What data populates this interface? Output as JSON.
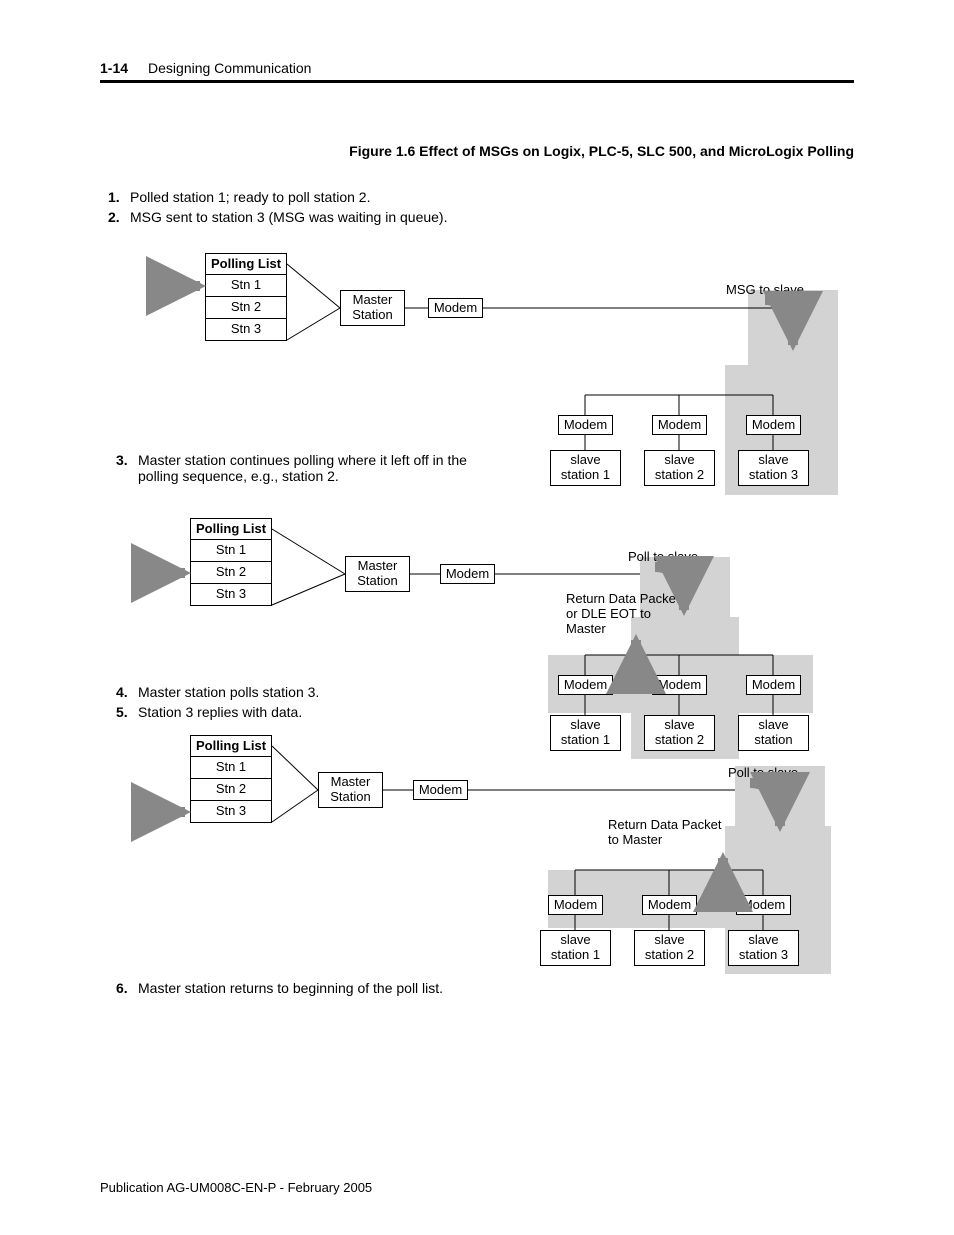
{
  "header": {
    "pgnum": "1-14",
    "section": "Designing Communication"
  },
  "figure_caption": "Figure 1.6    Effect of MSGs on Logix, PLC-5, SLC 500, and MicroLogix Polling",
  "steps": {
    "s1": {
      "n": "1.",
      "t": "Polled station 1; ready to poll station 2."
    },
    "s2": {
      "n": "2.",
      "t": "MSG sent to station 3 (MSG was waiting in queue)."
    },
    "s3": {
      "n": "3.",
      "t": "Master station continues polling where it left off in the polling sequence, e.g., station 2."
    },
    "s4": {
      "n": "4.",
      "t": "Master station polls station 3."
    },
    "s5": {
      "n": "5.",
      "t": "Station 3 replies with data."
    },
    "s6": {
      "n": "6.",
      "t": "Master station returns to beginning of the poll list."
    }
  },
  "polling": {
    "title": "Polling List",
    "stn1": "Stn 1",
    "stn2": "Stn 2",
    "stn3": "Stn 3"
  },
  "nodes": {
    "master": "Master\nStation",
    "modem": "Modem",
    "slave1": "slave\nstation 1",
    "slave2": "slave\nstation 2",
    "slave3": "slave\nstation 3",
    "slave": "slave\nstation"
  },
  "labels": {
    "msg_to_slave": "MSG to slave",
    "poll_to_slave": "Poll to slave",
    "return1": "Return Data Packet\nor DLE EOT to\nMaster",
    "return2": "Return Data Packet\nto Master"
  },
  "footer": "Publication AG-UM008C-EN-P - February 2005"
}
